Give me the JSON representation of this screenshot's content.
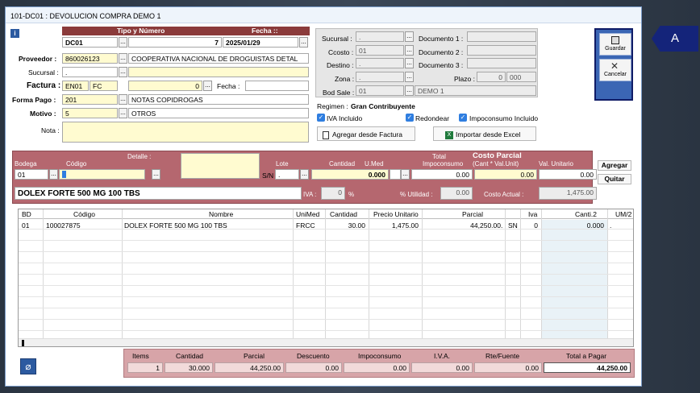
{
  "window_title": "101-DC01 : DEVOLUCION COMPRA DEMO 1",
  "header": {
    "tipo_numero_label": "Tipo y Número",
    "fecha_label": "Fecha ::",
    "tipo": "DC01",
    "numero": "7",
    "fecha": "2025/01/29",
    "proveedor_label": "Proveedor :",
    "proveedor_code": "860026123",
    "proveedor_name": "COOPERATIVA NACIONAL DE DROGUISTAS DETAL",
    "sucursal_label": "Sucursal :",
    "sucursal_value": ".",
    "factura_label": "Factura :",
    "factura_prefix": "EN01",
    "factura_type": "FC",
    "factura_number": "0",
    "factura_fecha_label": "Fecha :",
    "forma_pago_label": "Forma Pago :",
    "forma_pago_code": "201",
    "forma_pago_name": "NOTAS COPIDROGAS",
    "motivo_label": "Motivo :",
    "motivo_code": "5",
    "motivo_name": "OTROS",
    "nota_label": "Nota :"
  },
  "info": {
    "sucursal_label": "Sucursal :",
    "sucursal": ".",
    "ccosto_label": "Ccosto :",
    "ccosto": "01",
    "destino_label": "Destino :",
    "destino": ".",
    "zona_label": "Zona :",
    "zona": ".",
    "bodsale_label": "Bod Sale :",
    "bodsale": "01",
    "bodsale_name": "DEMO 1",
    "doc1_label": "Documento 1 :",
    "doc2_label": "Documento 2 :",
    "doc3_label": "Documento 3 :",
    "plazo_label": "Plazo :",
    "plazo_a": "0",
    "plazo_b": "000",
    "regimen_label": "Regimen :",
    "regimen": "Gran Contribuyente",
    "iva_incluido": "IVA Incluido",
    "redondear": "Redondear",
    "impoconsumo": "Impoconsumo Incluido",
    "btn_factura": "Agregar desde Factura",
    "btn_excel": "Importar desde Excel"
  },
  "actions": {
    "guardar": "Guardar",
    "cancelar": "Cancelar"
  },
  "detail": {
    "h_bodega": "Bodega",
    "h_codigo": "Código",
    "h_detalle": "Detalle :",
    "h_lote": "Lote",
    "h_cantidad": "Cantidad",
    "h_umed": "U.Med",
    "h_total_impo_1": "Total",
    "h_total_impo_2": "Impoconsumo",
    "h_costo_1": "Costo Parcial",
    "h_costo_2": "(Cant * Val.Unit)",
    "h_valunit": "Val. Unitario",
    "bodega": "01",
    "sn": "S/N",
    "lote": ".",
    "cantidad": "0.000",
    "total_impo": "0.00",
    "costo_parcial": "0.00",
    "val_unitario": "0.00",
    "product_name": "DOLEX FORTE 500 MG 100 TBS",
    "iva_label": "IVA :",
    "iva": "0",
    "pct": "%",
    "utilidad_label": "% Utilidad :",
    "utilidad": "0.00",
    "costo_actual_label": "Costo Actual :",
    "costo_actual": "1,475.00",
    "btn_agregar": "Agregar",
    "btn_quitar": "Quitar"
  },
  "grid": {
    "headers": [
      "BD",
      "Código",
      "Nombre",
      "UniMed",
      "Cantidad",
      "Precio Unitario",
      "Parcial",
      "Iva",
      "Canti.2",
      "UM/2"
    ],
    "rows": [
      {
        "bd": "01",
        "codigo": "100027875",
        "nombre": "DOLEX FORTE 500 MG 100 TBS",
        "unimed": "FRCC",
        "cantidad": "30.00",
        "precio": "1,475.00",
        "parcial": "44,250.00",
        "dot": ".",
        "sn": "SN",
        "iva": "0",
        "canti2": "0.000",
        "um2": "."
      }
    ]
  },
  "totals": {
    "items_label": "Items",
    "cantidad_label": "Cantidad",
    "parcial_label": "Parcial",
    "descuento_label": "Descuento",
    "impoconsumo_label": "Impoconsumo",
    "iva_label": "I.V.A.",
    "rte_label": "Rte/Fuente",
    "total_label": "Total a Pagar",
    "items": "1",
    "cantidad": "30.000",
    "parcial": "44,250.00",
    "descuento": "0.00",
    "impoconsumo": "0.00",
    "iva": "0.00",
    "rte": "0.00",
    "total": "44,250.00"
  },
  "marker": "A"
}
